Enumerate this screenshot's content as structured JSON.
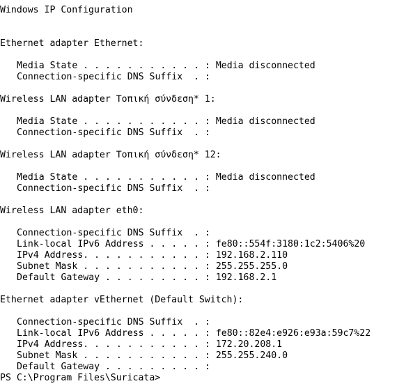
{
  "title": "Windows IP Configuration",
  "adapters": [
    {
      "header": "Ethernet adapter Ethernet:",
      "rows": [
        {
          "label": "Media State . . . . . . . . . . . : ",
          "value": "Media disconnected"
        },
        {
          "label": "Connection-specific DNS Suffix  . : ",
          "value": ""
        }
      ]
    },
    {
      "header": "Wireless LAN adapter Τοπική σύνδεση* 1:",
      "rows": [
        {
          "label": "Media State . . . . . . . . . . . : ",
          "value": "Media disconnected"
        },
        {
          "label": "Connection-specific DNS Suffix  . : ",
          "value": ""
        }
      ]
    },
    {
      "header": "Wireless LAN adapter Τοπική σύνδεση* 12:",
      "rows": [
        {
          "label": "Media State . . . . . . . . . . . : ",
          "value": "Media disconnected"
        },
        {
          "label": "Connection-specific DNS Suffix  . : ",
          "value": ""
        }
      ]
    },
    {
      "header": "Wireless LAN adapter eth0:",
      "rows": [
        {
          "label": "Connection-specific DNS Suffix  . : ",
          "value": ""
        },
        {
          "label": "Link-local IPv6 Address . . . . . : ",
          "value": "fe80::554f:3180:1c2:5406%20"
        },
        {
          "label": "IPv4 Address. . . . . . . . . . . : ",
          "value": "192.168.2.110"
        },
        {
          "label": "Subnet Mask . . . . . . . . . . . : ",
          "value": "255.255.255.0"
        },
        {
          "label": "Default Gateway . . . . . . . . . : ",
          "value": "192.168.2.1"
        }
      ]
    },
    {
      "header": "Ethernet adapter vEthernet (Default Switch):",
      "rows": [
        {
          "label": "Connection-specific DNS Suffix  . : ",
          "value": ""
        },
        {
          "label": "Link-local IPv6 Address . . . . . : ",
          "value": "fe80::82e4:e926:e93a:59c7%22"
        },
        {
          "label": "IPv4 Address. . . . . . . . . . . : ",
          "value": "172.20.208.1"
        },
        {
          "label": "Subnet Mask . . . . . . . . . . . : ",
          "value": "255.255.240.0"
        },
        {
          "label": "Default Gateway . . . . . . . . . : ",
          "value": ""
        }
      ]
    }
  ],
  "prompt": "PS C:\\Program Files\\Suricata>"
}
